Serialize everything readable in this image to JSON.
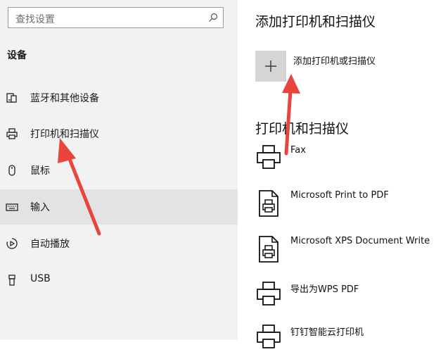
{
  "search": {
    "placeholder": "查找设置"
  },
  "sidebar": {
    "section_title": "设备",
    "items": [
      {
        "label": "蓝牙和其他设备",
        "icon": "bluetooth-devices-icon"
      },
      {
        "label": "打印机和扫描仪",
        "icon": "printer-icon"
      },
      {
        "label": "鼠标",
        "icon": "mouse-icon"
      },
      {
        "label": "输入",
        "icon": "keyboard-icon",
        "selected": true
      },
      {
        "label": "自动播放",
        "icon": "autoplay-icon"
      },
      {
        "label": "USB",
        "icon": "usb-icon"
      }
    ]
  },
  "main": {
    "title": "添加打印机和扫描仪",
    "add_label": "添加打印机或扫描仪",
    "subtitle": "打印机和扫描仪",
    "devices": [
      {
        "name": "Fax",
        "icon": "printer-icon"
      },
      {
        "name": "Microsoft Print to PDF",
        "icon": "pdf-printer-icon"
      },
      {
        "name": "Microsoft XPS Document Write",
        "icon": "pdf-printer-icon"
      },
      {
        "name": "导出为WPS PDF",
        "icon": "printer-icon"
      },
      {
        "name": "钉钉智能云打印机",
        "icon": "printer-icon"
      }
    ]
  },
  "colors": {
    "sidebar_bg": "#f2f2f2",
    "selected_bg": "#e3e3e3",
    "add_tile_bg": "#d5d5d5",
    "arrow": "#e8453c"
  }
}
